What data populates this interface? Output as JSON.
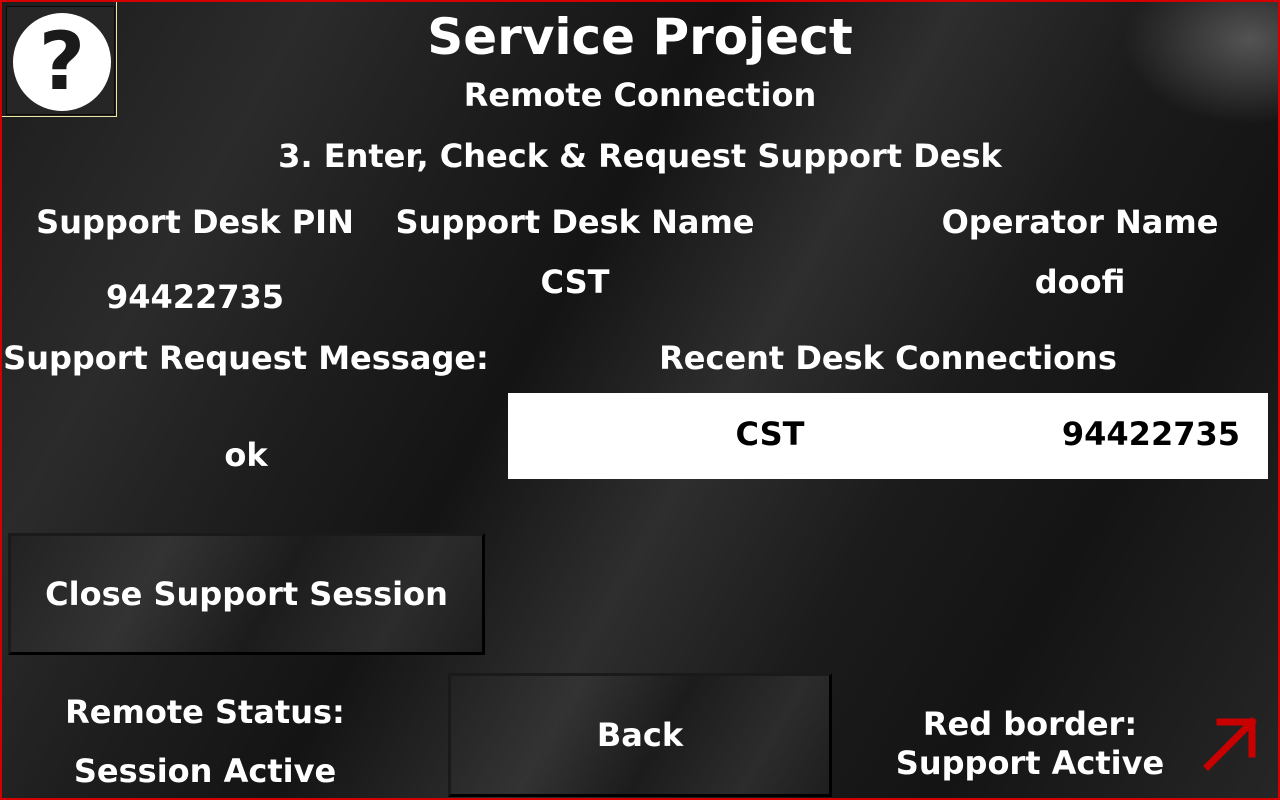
{
  "header": {
    "help_icon_glyph": "?",
    "title": "Service Project",
    "subtitle": "Remote Connection",
    "step": "3. Enter, Check & Request Support Desk"
  },
  "fields": {
    "pin_label": "Support Desk PIN",
    "pin_value": "94422735",
    "name_label": "Support Desk Name",
    "name_value": "CST",
    "operator_label": "Operator Name",
    "operator_value": "doofi",
    "message_label": "Support Request Message:",
    "message_value": "ok"
  },
  "recent": {
    "label": "Recent Desk Connections",
    "rows": [
      {
        "name": "CST",
        "pin": "94422735"
      }
    ]
  },
  "buttons": {
    "close_session": "Close Support Session",
    "back": "Back"
  },
  "status": {
    "label": "Remote Status:",
    "value": "Session Active"
  },
  "legend": {
    "line1": "Red border:",
    "line2": "Support Active",
    "icon": "arrow-up-right-icon"
  },
  "colors": {
    "border_active": "#d40000",
    "arrow": "#c80000",
    "help_highlight": "#efe6a0"
  }
}
